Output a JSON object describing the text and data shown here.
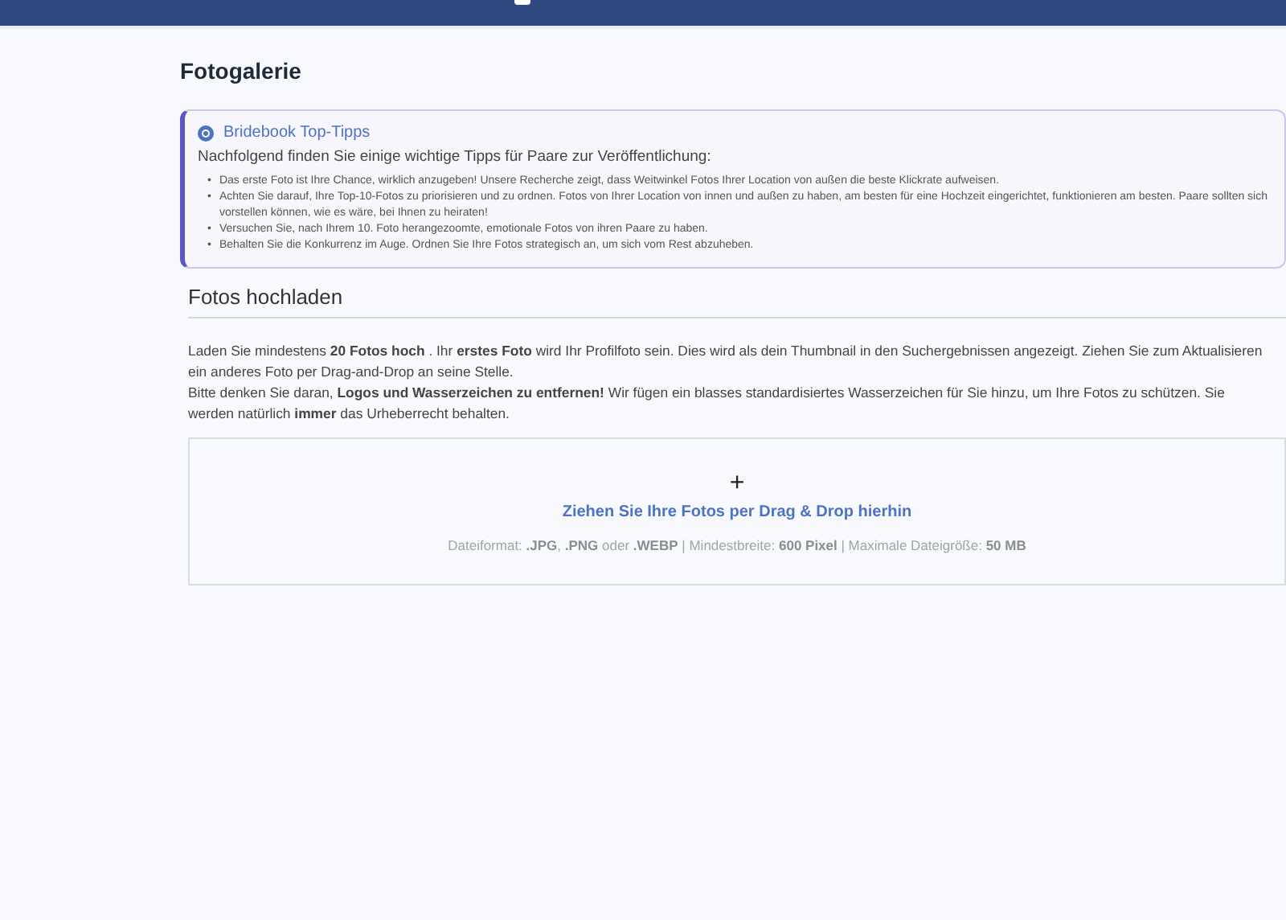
{
  "page_title": "Fotogalerie",
  "tips": {
    "title": "Bridebook Top-Tipps",
    "intro": "Nachfolgend finden Sie einige wichtige Tipps für Paare zur Veröffentlichung:",
    "items": [
      {
        "bullet": "•",
        "text": "Das erste Foto ist Ihre Chance, wirklich anzugeben! Unsere Recherche zeigt, dass Weitwinkel Fotos Ihrer Location von außen die beste Klickrate aufweisen."
      },
      {
        "bullet": "•",
        "text": "Achten Sie darauf, Ihre Top-10-Fotos zu priorisieren und zu ordnen. Fotos von Ihrer Location von innen und außen zu haben, am besten für eine Hochzeit eingerichtet, funktionieren am besten. Paare sollten sich vorstellen können, wie es wäre, bei Ihnen zu heiraten!"
      },
      {
        "bullet": "•",
        "text": "Versuchen Sie, nach Ihrem 10. Foto herangezoomte, emotionale Fotos von ihren Paare zu haben."
      },
      {
        "bullet": "•",
        "text": "Behalten Sie die Konkurrenz im Auge. Ordnen Sie Ihre Fotos strategisch an, um sich vom Rest abzuheben."
      }
    ]
  },
  "upload": {
    "heading": "Fotos hochladen",
    "paragraphs": [
      "Laden Sie mindestens **20 Fotos hoch** . Ihr **erstes Foto** wird Ihr Profilfoto sein. Dies wird als dein Thumbnail in den Suchergebnissen angezeigt. Ziehen Sie zum Aktualisieren ein anderes Foto per Drag-and-Drop an seine Stelle.",
      "Bitte denken Sie daran, **Logos und Wasserzeichen zu entfernen!** Wir fügen ein blasses standardisiertes Wasserzeichen für Sie hinzu, um Ihre Fotos zu schützen. Sie werden natürlich **immer** das Urheberrecht behalten."
    ],
    "dropzone": {
      "plus": "+",
      "label": "Ziehen Sie Ihre Fotos per Drag & Drop hierhin",
      "info": "Dateiformat: **.JPG**, **.PNG** oder **.WEBP** | Mindestbreite: **600 Pixel** | Maximale Dateigröße: **50 MB**"
    }
  }
}
